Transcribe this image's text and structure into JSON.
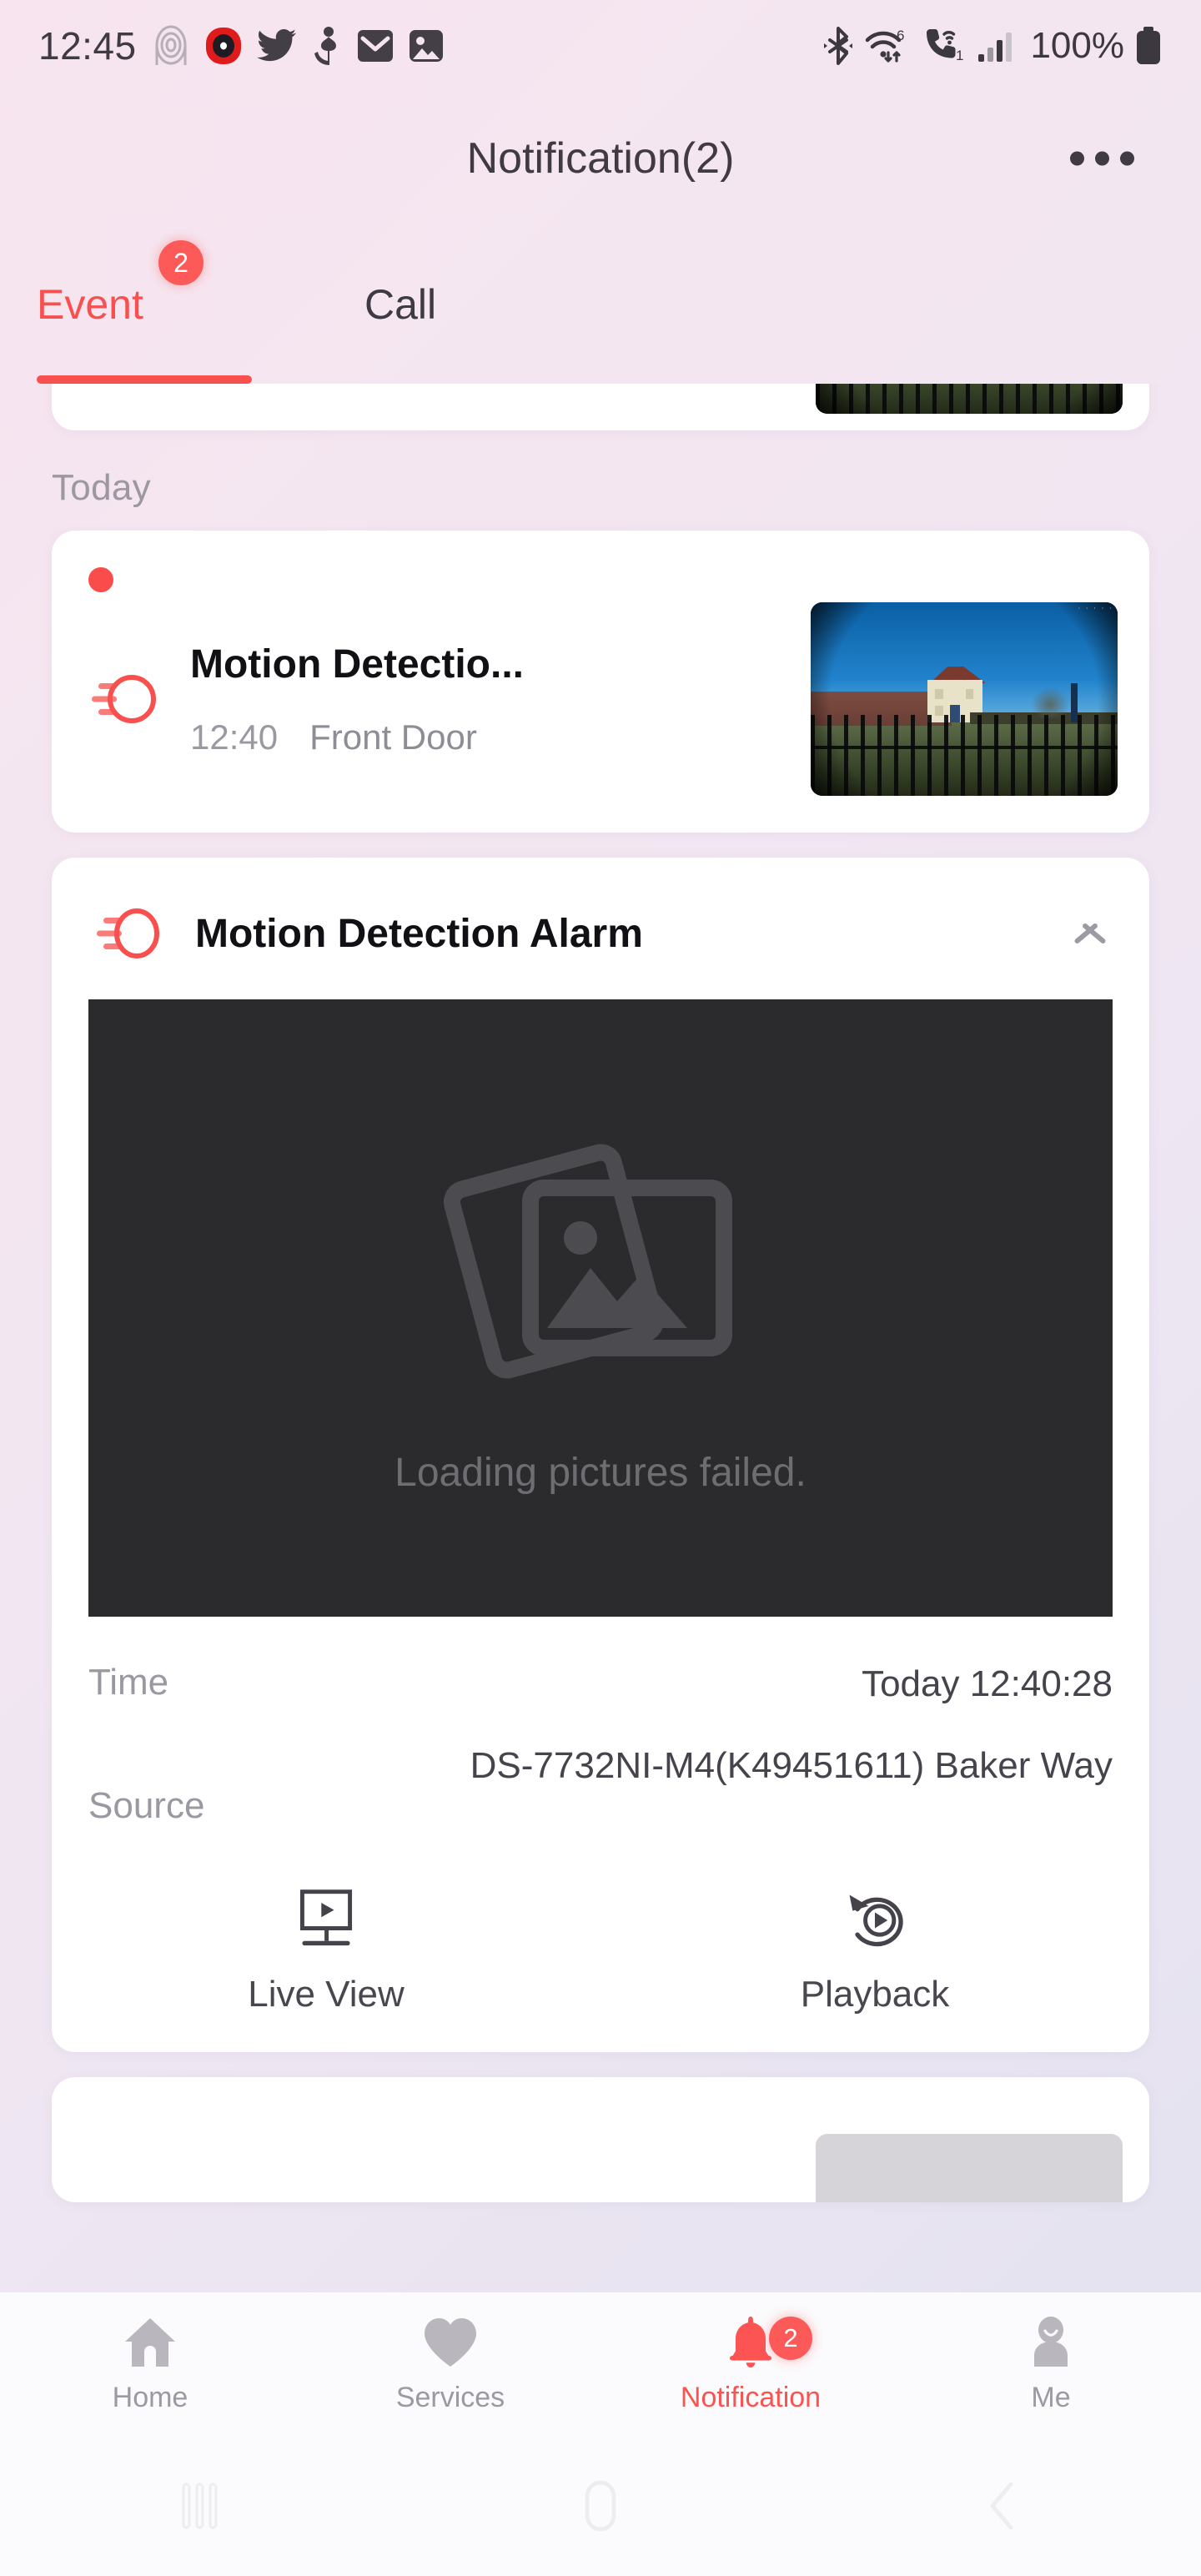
{
  "statusbar": {
    "time": "12:45",
    "battery_percent": "100%",
    "wifi_generation": "6",
    "call_badge": "1",
    "left_icons": [
      "nfc-icon",
      "record-icon",
      "twitter-icon",
      "anchor-icon",
      "mail-icon",
      "gallery-icon"
    ],
    "right_icons": [
      "bluetooth-icon",
      "wifi-icon",
      "wifi-calling-icon",
      "signal-bars-icon",
      "battery-icon"
    ]
  },
  "header": {
    "title": "Notification(2)",
    "menu_icon": "overflow-menu-icon"
  },
  "tabs": [
    {
      "label": "Event",
      "badge": "2",
      "active": true
    },
    {
      "label": "Call",
      "badge": "",
      "active": false
    }
  ],
  "list": {
    "section_header": "Today",
    "collapsed_event": {
      "icon": "motion-detection-icon",
      "title": "Motion Detectio...",
      "time": "12:40",
      "source": "Front Door",
      "unread": true
    },
    "expanded_event": {
      "icon": "motion-detection-icon",
      "title": "Motion Detection Alarm",
      "collapse_icon": "chevron-up-icon",
      "image_placeholder": {
        "icon": "broken-images-icon",
        "text": "Loading pictures failed."
      },
      "details": [
        {
          "label": "Time",
          "value": "Today 12:40:28"
        },
        {
          "label": "Source",
          "value": "DS-7732NI-M4(K49451611) Baker Way"
        }
      ],
      "actions": [
        {
          "label": "Live View",
          "icon": "live-view-monitor-icon"
        },
        {
          "label": "Playback",
          "icon": "playback-replay-icon"
        }
      ]
    }
  },
  "bottom_nav": [
    {
      "label": "Home",
      "icon": "home-icon",
      "active": false,
      "badge": ""
    },
    {
      "label": "Services",
      "icon": "heart-icon",
      "active": false,
      "badge": ""
    },
    {
      "label": "Notification",
      "icon": "bell-icon",
      "active": true,
      "badge": "2"
    },
    {
      "label": "Me",
      "icon": "person-icon",
      "active": false,
      "badge": ""
    }
  ],
  "android_nav": [
    {
      "icon": "recents-icon"
    },
    {
      "icon": "home-pill-icon"
    },
    {
      "icon": "back-chevron-icon"
    }
  ],
  "colors": {
    "accent_red": "#f8504e",
    "badge_red": "#fc5a59",
    "muted_gray": "#9b98a1",
    "card_white": "#ffffff",
    "placeholder_dark": "#2b2b2d"
  }
}
